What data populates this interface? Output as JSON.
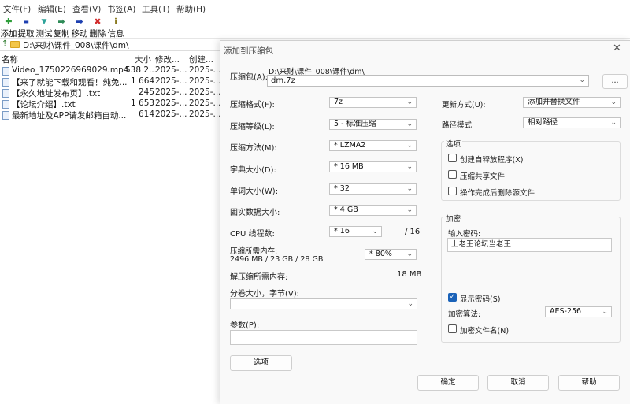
{
  "menu": [
    "文件(F)",
    "编辑(E)",
    "查看(V)",
    "书签(A)",
    "工具(T)",
    "帮助(H)"
  ],
  "toolbar": [
    {
      "label": "添加",
      "icon": "plus-icon",
      "glyph": "✚",
      "color": "#2e9e3a"
    },
    {
      "label": "提取",
      "icon": "minus-icon",
      "glyph": "▬",
      "color": "#1d3fb0"
    },
    {
      "label": "测试",
      "icon": "test-icon",
      "glyph": "▼",
      "color": "#2fa39a"
    },
    {
      "label": "复制",
      "icon": "copy-arrow-icon",
      "glyph": "➡",
      "color": "#2e8b57"
    },
    {
      "label": "移动",
      "icon": "move-arrow-icon",
      "glyph": "➡",
      "color": "#1d3fb0"
    },
    {
      "label": "删除",
      "icon": "delete-icon",
      "glyph": "✖",
      "color": "#d12a2a"
    },
    {
      "label": "信息",
      "icon": "info-icon",
      "glyph": "ℹ",
      "color": "#8a7a20"
    }
  ],
  "address": {
    "path": "D:\\来财\\课件_008\\课件\\dm\\"
  },
  "columns": {
    "name": "名称",
    "size": "大小",
    "modified": "修改...",
    "created": "创建..."
  },
  "files": [
    {
      "name": "Video_1750226969029.mp4",
      "size": "538 2...",
      "modified": "2025-...",
      "created": "2025-..."
    },
    {
      "name": "【来了就能下载和观看！纯免...",
      "size": "1 664",
      "modified": "2025-...",
      "created": "2025-..."
    },
    {
      "name": "【永久地址发布页】.txt",
      "size": "245",
      "modified": "2025-...",
      "created": "2025-..."
    },
    {
      "name": "【论坛介绍】.txt",
      "size": "1 653",
      "modified": "2025-...",
      "created": "2025-..."
    },
    {
      "name": "最新地址及APP请发邮箱自动...",
      "size": "614",
      "modified": "2025-...",
      "created": "2025-..."
    }
  ],
  "dialog": {
    "title": "添加到压缩包",
    "archive_label": "压缩包(A):",
    "archive_dir": "D:\\来财\\课件_008\\课件\\dm\\",
    "archive_name": "dm.7z",
    "browse_label": "...",
    "format_label": "压缩格式(F):",
    "format_value": "7z",
    "level_label": "压缩等级(L):",
    "level_value": "5 - 标准压缩",
    "method_label": "压缩方法(M):",
    "method_value": "*  LZMA2",
    "dict_label": "字典大小(D):",
    "dict_value": "*  16 MB",
    "word_label": "单词大小(W):",
    "word_value": "*  32",
    "solid_label": "固实数据大小:",
    "solid_value": "*  4 GB",
    "cpu_label": "CPU 线程数:",
    "cpu_value": "*  16",
    "cpu_total": "/ 16",
    "mem_comp_label": "压缩所需内存:",
    "mem_comp_value": "2496 MB / 23 GB / 28 GB",
    "mem_percent": "* 80%",
    "mem_decomp_label": "解压缩所需内存:",
    "mem_decomp_value": "18 MB",
    "split_label": "分卷大小，字节(V):",
    "split_value": "",
    "params_label": "参数(P):",
    "params_value": "",
    "options_button": "选项",
    "update_label": "更新方式(U):",
    "update_value": "添加并替换文件",
    "path_label": "路径模式",
    "path_value": "相对路径",
    "options_group": "选项",
    "opt_sfx": "创建自释放程序(X)",
    "opt_shared": "压缩共享文件",
    "opt_delete": "操作完成后删除源文件",
    "encrypt_group": "加密",
    "password_label": "输入密码:",
    "password_value": "上老王论坛当老王",
    "show_password": "显示密码(S)",
    "enc_method_label": "加密算法:",
    "enc_method_value": "AES-256",
    "enc_names": "加密文件名(N)",
    "ok": "确定",
    "cancel": "取消",
    "help": "帮助"
  }
}
